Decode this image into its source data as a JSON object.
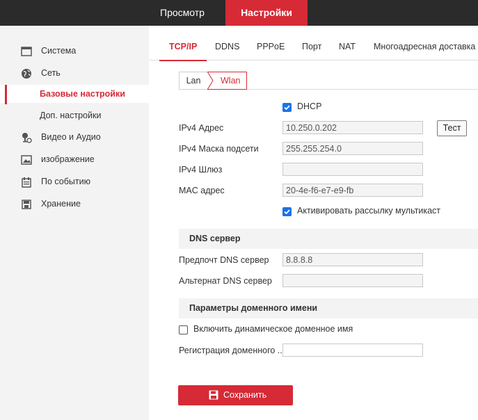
{
  "topnav": {
    "view_label": "Просмотр",
    "settings_label": "Настройки"
  },
  "sidebar": {
    "items": [
      {
        "label": "Система",
        "icon": "system-icon"
      },
      {
        "label": "Сеть",
        "icon": "network-globe-icon"
      },
      {
        "label": "Базовые настройки",
        "active": true
      },
      {
        "label": "Доп. настройки"
      },
      {
        "label": "Видео и Аудио",
        "icon": "video-audio-icon"
      },
      {
        "label": "изображение",
        "icon": "image-icon"
      },
      {
        "label": "По событию",
        "icon": "event-icon"
      },
      {
        "label": "Хранение",
        "icon": "storage-icon"
      }
    ]
  },
  "tabs": [
    "TCP/IP",
    "DDNS",
    "PPPoE",
    "Порт",
    "NAT",
    "Многоадресная доставка"
  ],
  "subtabs": {
    "lan": "Lan",
    "wlan": "Wlan"
  },
  "form": {
    "dhcp_label": "DHCP",
    "dhcp_checked": true,
    "ipv4_address_label": "IPv4 Адрес",
    "ipv4_address_value": "10.250.0.202",
    "test_label": "Тест",
    "ipv4_mask_label": "IPv4 Маска подсети",
    "ipv4_mask_value": "255.255.254.0",
    "ipv4_gateway_label": "IPv4 Шлюз",
    "ipv4_gateway_value": "",
    "mac_label": "MAC адрес",
    "mac_value": "20-4e-f6-e7-e9-fb",
    "multicast_label": "Активировать рассылку мультикаст",
    "multicast_checked": true
  },
  "dns": {
    "section_title": "DNS сервер",
    "preferred_label": "Предпочт DNS сервер",
    "preferred_value": "8.8.8.8",
    "alternate_label": "Альтернат DNS сервер",
    "alternate_value": ""
  },
  "domain": {
    "section_title": "Параметры доменного имени",
    "enable_label": "Включить динамическое доменное имя",
    "enable_checked": false,
    "registration_label": "Регистрация доменного ...",
    "registration_value": ""
  },
  "save_label": "Сохранить",
  "colors": {
    "accent": "#d62a36",
    "topbar": "#2b2b2b",
    "checkbox": "#1a73e8",
    "sidebar_bg": "#f3f3f3"
  }
}
